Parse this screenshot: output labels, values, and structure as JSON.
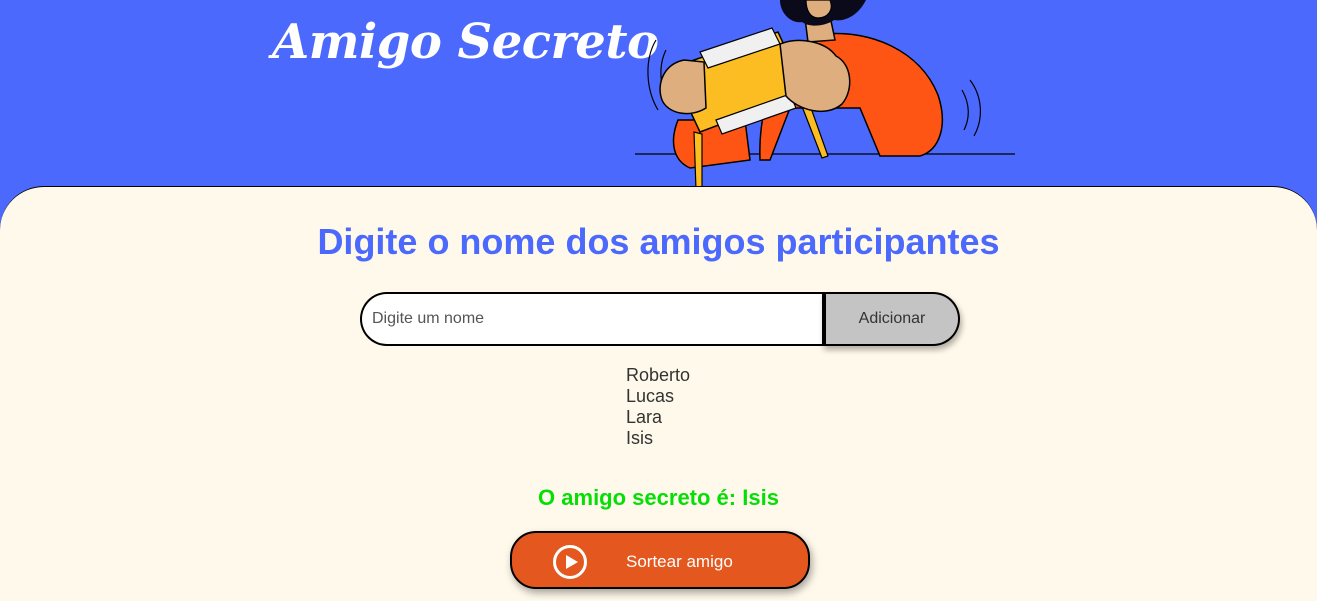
{
  "header": {
    "title": "Amigo Secreto",
    "illustration_icon": "person-holding-gift-box-illustration"
  },
  "main": {
    "section_title": "Digite o nome dos amigos participantes",
    "input": {
      "placeholder": "Digite um nome",
      "value": ""
    },
    "add_button_label": "Adicionar",
    "friends": [
      "Roberto",
      "Lucas",
      "Lara",
      "Isis"
    ],
    "result": {
      "prefix": "O amigo secreto é:",
      "name": "Isis"
    },
    "draw_button": {
      "label": "Sortear amigo",
      "icon": "play-circle-icon"
    }
  },
  "colors": {
    "header_bg": "#4b69fd",
    "main_bg": "#fff9eb",
    "title_blue": "#4b69fd",
    "result_green": "#05df05",
    "draw_button_bg": "#e4581f",
    "add_button_bg": "#c4c4c4"
  }
}
